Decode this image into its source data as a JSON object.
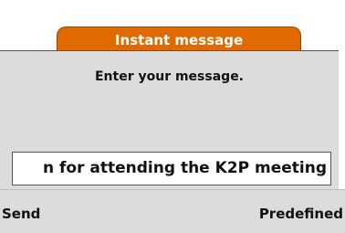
{
  "header": {
    "title": "Instant message"
  },
  "prompt": {
    "text": "Enter your message."
  },
  "message": {
    "visible_value": "n for attending the K2P meeting"
  },
  "softkeys": {
    "left_label": "Send",
    "right_label": "Predefined"
  },
  "colors": {
    "tab_accent": "#e06a00",
    "panel_background": "#dcdcdc"
  }
}
